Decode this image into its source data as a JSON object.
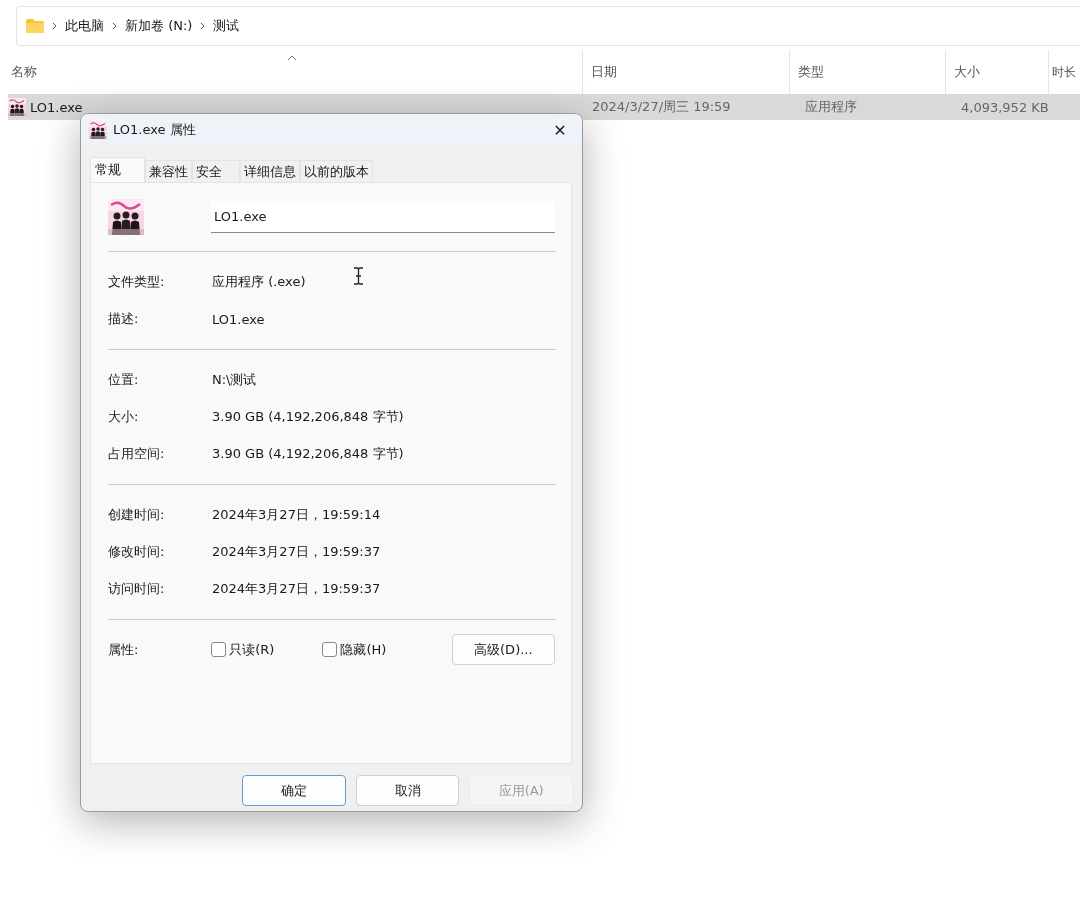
{
  "explorer": {
    "breadcrumb": [
      "此电脑",
      "新加卷 (N:)",
      "测试"
    ],
    "columns": [
      "名称",
      "日期",
      "类型",
      "大小",
      "时长"
    ],
    "rows": [
      {
        "name": "LO1.exe",
        "date": "2024/3/27/周三 19:59",
        "type": "应用程序",
        "size": "4,093,952 KB",
        "selected": true
      }
    ]
  },
  "dialog": {
    "title": "LO1.exe 属性",
    "close": "✕",
    "tabs": [
      {
        "label": "常规",
        "selected": true
      },
      {
        "label": "兼容性",
        "selected": false
      },
      {
        "label": "安全",
        "selected": false
      },
      {
        "label": "详细信息",
        "selected": false
      },
      {
        "label": "以前的版本",
        "selected": false
      }
    ],
    "file_name": "LO1.exe",
    "sections": [
      [
        {
          "label": "文件类型:",
          "value": "应用程序 (.exe)"
        },
        {
          "label": "描述:",
          "value": "LO1.exe"
        }
      ],
      [
        {
          "label": "位置:",
          "value": "N:\\测试"
        },
        {
          "label": "大小:",
          "value": "3.90 GB (4,192,206,848 字节)"
        },
        {
          "label": "占用空间:",
          "value": "3.90 GB (4,192,206,848 字节)"
        }
      ],
      [
        {
          "label": "创建时间:",
          "value": "2024年3月27日，19:59:14"
        },
        {
          "label": "修改时间:",
          "value": "2024年3月27日，19:59:37"
        },
        {
          "label": "访问时间:",
          "value": "2024年3月27日，19:59:37"
        }
      ]
    ],
    "attributes_label": "属性:",
    "checkboxes": [
      {
        "label": "只读(R)",
        "checked": false
      },
      {
        "label": "隐藏(H)",
        "checked": false
      }
    ],
    "advanced_button": "高级(D)...",
    "buttons": [
      {
        "label": "确定",
        "kind": "default"
      },
      {
        "label": "取消",
        "kind": "normal"
      },
      {
        "label": "应用(A)",
        "kind": "disabled"
      }
    ]
  }
}
